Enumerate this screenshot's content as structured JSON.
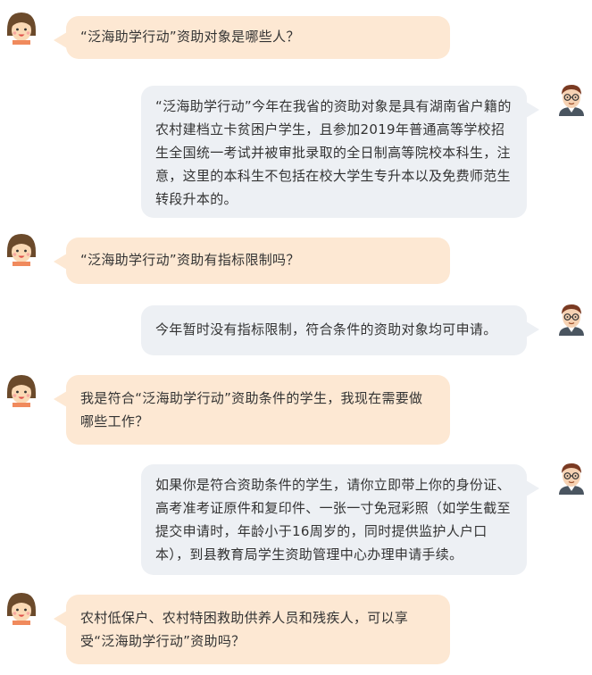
{
  "messages": [
    {
      "role": "asker",
      "text": "“泛海助学行动”资助对象是哪些人？"
    },
    {
      "role": "answerer",
      "text": "“泛海助学行动”今年在我省的资助对象是具有湖南省户籍的农村建档立卡贫困户学生，且参加2019年普通高等学校招生全国统一考试并被审批录取的全日制高等院校本科生，注意，这里的本科生不包括在校大学生专升本以及免费师范生转段升本的。"
    },
    {
      "role": "asker",
      "text": "“泛海助学行动”资助有指标限制吗？"
    },
    {
      "role": "answerer",
      "text": "今年暂时没有指标限制，符合条件的资助对象均可申请。"
    },
    {
      "role": "asker",
      "text": "我是符合“泛海助学行动”资助条件的学生，我现在需要做哪些工作？"
    },
    {
      "role": "answerer",
      "text": "如果你是符合资助条件的学生，请你立即带上你的身份证、高考准考证原件和复印件、一张一寸免冠彩照（如学生截至提交申请时，年龄小于16周岁的，同时提供监护人户口本），到县教育局学生资助管理中心办理申请手续。"
    },
    {
      "role": "asker",
      "text": "农村低保户、农村特困救助供养人员和残疾人，可以享受“泛海助学行动”资助吗？"
    }
  ],
  "icons": {
    "asker_avatar": "girl-avatar-icon",
    "answerer_avatar": "man-with-glasses-avatar-icon"
  },
  "colors": {
    "question_bubble": "#fde8d3",
    "answer_bubble": "#edf0f4",
    "text": "#333333"
  }
}
